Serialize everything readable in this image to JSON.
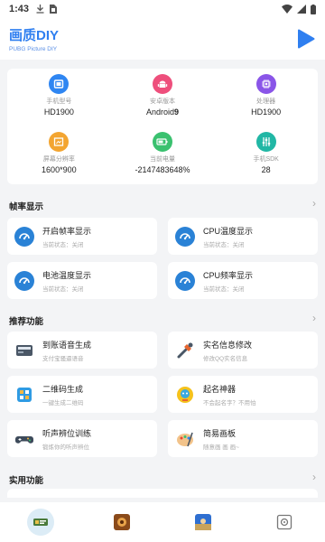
{
  "status": {
    "time": "1:43"
  },
  "app": {
    "title": "画质DIY",
    "subtitle": "PUBG Picture DIY"
  },
  "device_info": [
    {
      "label": "手机型号",
      "value": "HD1900",
      "icon": "phone-icon",
      "color": "#2f86f2"
    },
    {
      "label": "安卓版本",
      "value": "Android",
      "value_bold": "9",
      "icon": "android-icon",
      "color": "#ee4f7c"
    },
    {
      "label": "处理器",
      "value": "HD1900",
      "icon": "cpu-icon",
      "color": "#8a55e8"
    },
    {
      "label": "屏幕分辨率",
      "value": "1600*900",
      "icon": "screen-icon",
      "color": "#f3a531"
    },
    {
      "label": "当前电量",
      "value": "-2147483648%",
      "icon": "battery-icon",
      "color": "#3ac16f"
    },
    {
      "label": "手机SDK",
      "value": "28",
      "icon": "sliders-icon",
      "color": "#21b7a5"
    }
  ],
  "sections": {
    "fps": {
      "title": "帧率显示"
    },
    "recommend": {
      "title": "推荐功能"
    },
    "utility": {
      "title": "实用功能"
    }
  },
  "fps_cards": [
    {
      "name": "开启帧率显示",
      "sub": "当前状态：关闭"
    },
    {
      "name": "CPU温度显示",
      "sub": "当前状态：关闭"
    },
    {
      "name": "电池温度显示",
      "sub": "当前状态：关闭"
    },
    {
      "name": "CPU频率显示",
      "sub": "当前状态：关闭"
    }
  ],
  "recommend_cards": [
    {
      "name": "到账语音生成",
      "sub": "支付宝骚逼语音",
      "icon": "voice-card-icon"
    },
    {
      "name": "实名信息修改",
      "sub": "修改QQ实名信息",
      "icon": "edit-tool-icon"
    },
    {
      "name": "二维码生成",
      "sub": "一键生成二维码",
      "icon": "qrcode-icon"
    },
    {
      "name": "起名神器",
      "sub": "不会起名字？不用怕",
      "icon": "name-bot-icon"
    },
    {
      "name": "听声辨位训练",
      "sub": "锻炼你的听声辨位",
      "icon": "gamepad-icon"
    },
    {
      "name": "简易画板",
      "sub": "随意画 画 画~",
      "icon": "drawing-board-icon"
    }
  ],
  "colors": {
    "accent": "#2f7ff0",
    "fps_icon": "#2a82d6"
  }
}
